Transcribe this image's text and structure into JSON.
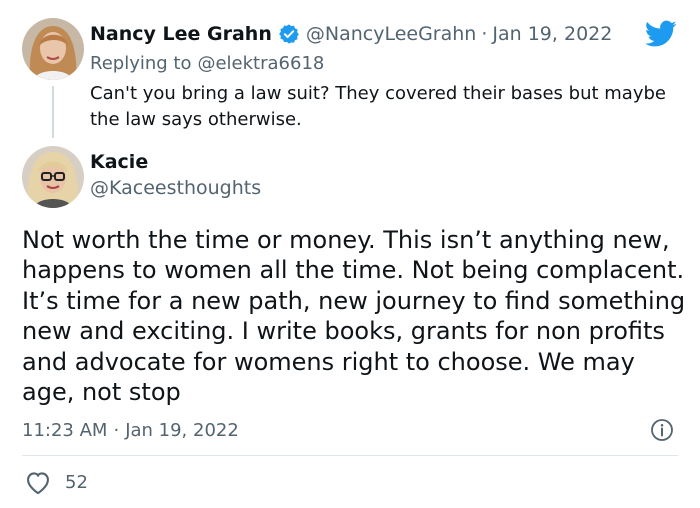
{
  "parent_tweet": {
    "display_name": "Nancy Lee Grahn",
    "handle": "@NancyLeeGrahn",
    "separator": "·",
    "date": "Jan 19, 2022",
    "replying_prefix": "Replying to",
    "replying_handle": "@elektra6618",
    "text": "Can't you bring a law suit? They covered their bases but maybe the law says otherwise."
  },
  "main_tweet": {
    "display_name": "Kacie",
    "handle": "@Kaceesthoughts",
    "text": "Not worth the time or money. This isn’t anything new, happens to women all the time. Not being complacent. It’s time for a new path, new journey to find something new and exciting. I write books, grants for non profits and advocate for womens right to choose. We may age, not stop",
    "time": "11:23 AM",
    "separator": "·",
    "date": "Jan 19, 2022",
    "like_count": "52"
  },
  "icons": {
    "brand": "twitter-bird-icon",
    "verified": "verified-badge-icon",
    "info": "info-icon",
    "like": "heart-icon"
  },
  "colors": {
    "brand_blue": "#1d9bf0",
    "text": "#0f1419",
    "muted": "#536471",
    "thread_line": "#cfd9de"
  }
}
